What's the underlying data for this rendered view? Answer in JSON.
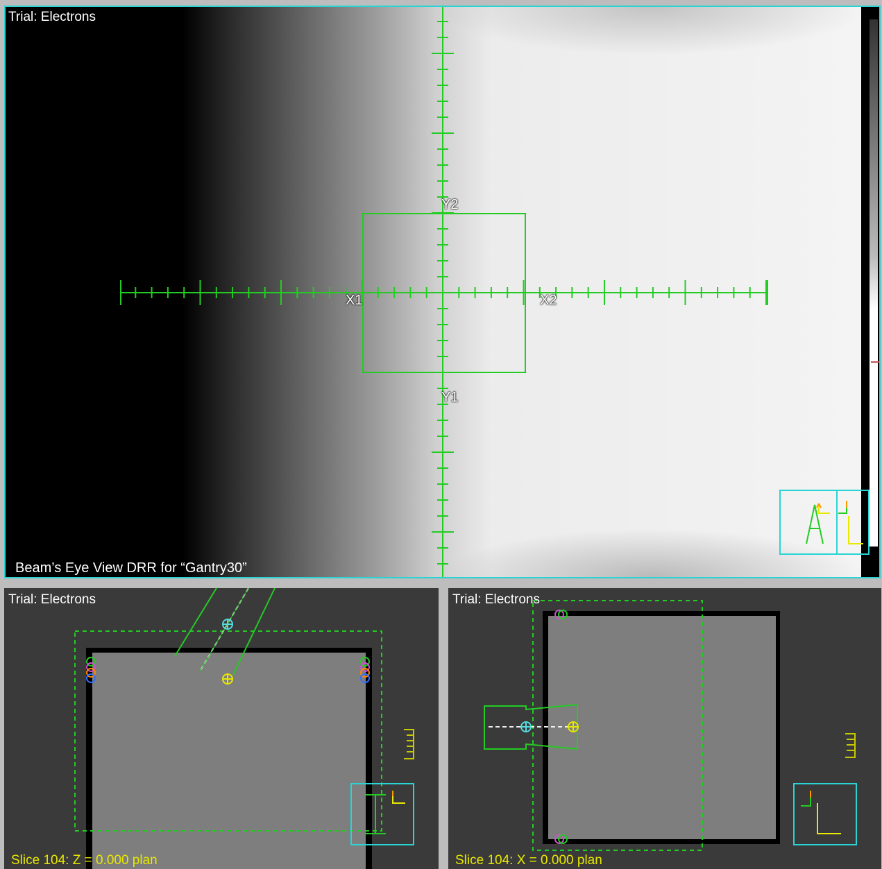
{
  "bev": {
    "trial_label": "Trial: Electrons",
    "caption": "Beam’s Eye View DRR for “Gantry30”",
    "jaw_labels": {
      "x1": "X1",
      "x2": "X2",
      "y1": "Y1",
      "y2": "Y2"
    },
    "orientation_letter": "A"
  },
  "axial": {
    "trial_label": "Trial: Electrons",
    "slice_label": "Slice 104: Z = 0.000 plan"
  },
  "sagittal": {
    "trial_label": "Trial: Electrons",
    "slice_label": "Slice 104: X = 0.000 plan"
  },
  "colors": {
    "frame_cyan": "#2ad4d4",
    "beam_green": "#22cc22",
    "slice_text_yellow": "#e8e800"
  }
}
